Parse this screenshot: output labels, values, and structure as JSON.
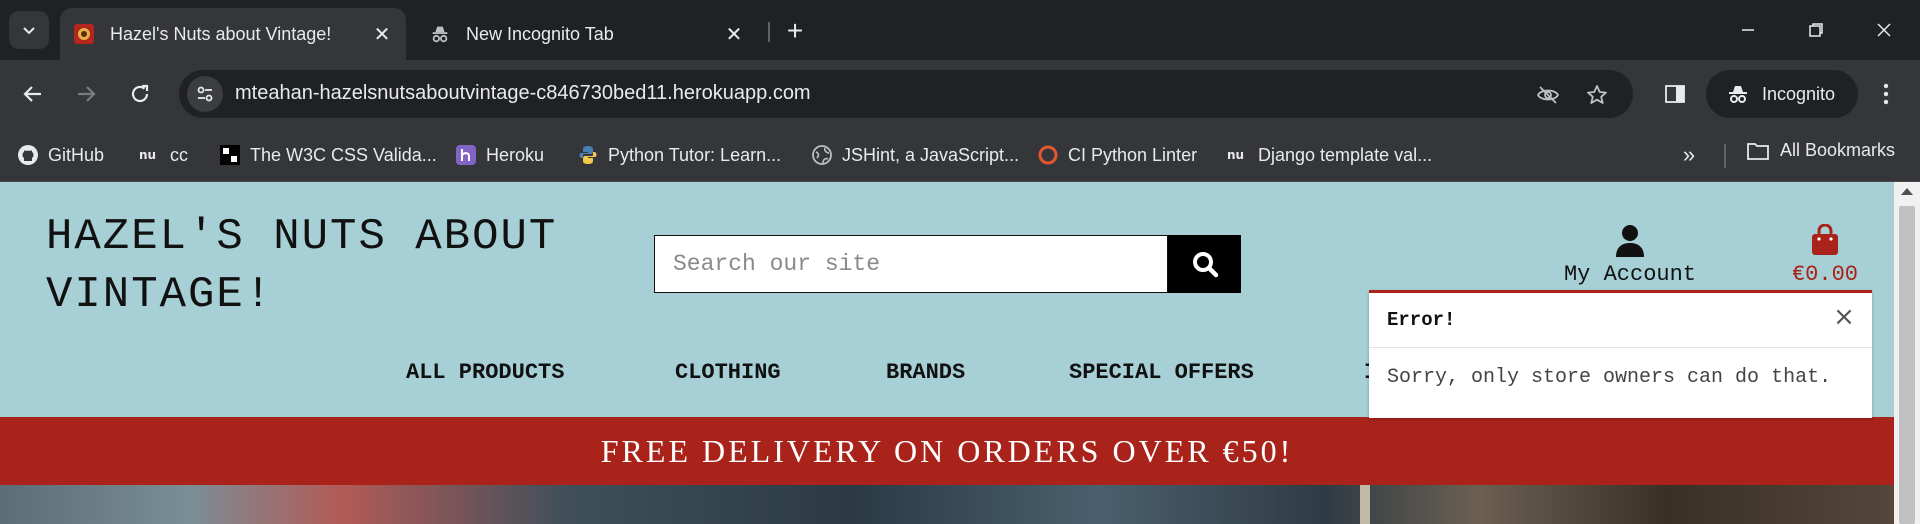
{
  "browser": {
    "tabs": [
      {
        "title": "Hazel's Nuts about Vintage!",
        "active": true
      },
      {
        "title": "New Incognito Tab",
        "active": false
      }
    ],
    "url": "mteahan-hazelsnutsaboutvintage-c846730bed11.herokuapp.com",
    "profile_label": "Incognito",
    "bookmarks": [
      {
        "label": "GitHub",
        "icon": "github-icon"
      },
      {
        "label": "cc",
        "icon": "nu-icon"
      },
      {
        "label": "The W3C CSS Valida...",
        "icon": "w3c-icon"
      },
      {
        "label": "Heroku",
        "icon": "heroku-icon"
      },
      {
        "label": "Python Tutor: Learn...",
        "icon": "python-icon"
      },
      {
        "label": "JSHint, a JavaScript...",
        "icon": "globe-icon"
      },
      {
        "label": "CI Python Linter",
        "icon": "ring-icon"
      },
      {
        "label": "Django template val...",
        "icon": "nu-icon"
      }
    ],
    "all_bookmarks_label": "All Bookmarks",
    "colors": {
      "frame": "#202124",
      "toolbar": "#35363a",
      "text": "#e8eaed"
    }
  },
  "site": {
    "logo_line1": "HAZEL'S NUTS ABOUT",
    "logo_line2": "VINTAGE!",
    "search_placeholder": "Search our site",
    "account_label": "My Account",
    "bag_total": "€0.00",
    "nav": [
      "ALL PRODUCTS",
      "CLOTHING",
      "BRANDS",
      "SPECIAL OFFERS",
      "I"
    ],
    "banner": "FREE DELIVERY ON ORDERS OVER €50!",
    "colors": {
      "header_bg": "#a6d0d5",
      "accent": "#a9231b"
    }
  },
  "toast": {
    "title": "Error!",
    "message": "Sorry, only store owners can do that."
  }
}
